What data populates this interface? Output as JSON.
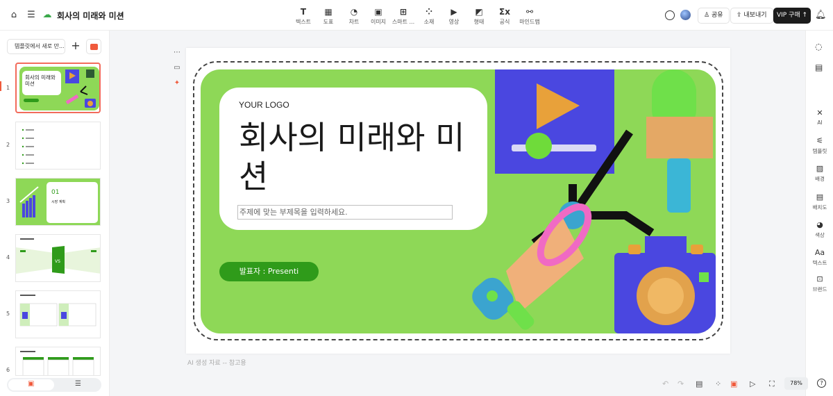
{
  "header": {
    "title": "회사의 미래와 미션",
    "tools": [
      {
        "label": "텍스트",
        "icon": "text-icon",
        "glyph": "T"
      },
      {
        "label": "도표",
        "icon": "table-icon",
        "glyph": "▦"
      },
      {
        "label": "차트",
        "icon": "chart-icon",
        "glyph": "◔"
      },
      {
        "label": "이미지",
        "icon": "image-icon",
        "glyph": "▣"
      },
      {
        "label": "스마트 ...",
        "icon": "smart-art-icon",
        "glyph": "⊞"
      },
      {
        "label": "소재",
        "icon": "elements-icon",
        "glyph": "⁘"
      },
      {
        "label": "영상",
        "icon": "video-icon",
        "glyph": "▶"
      },
      {
        "label": "형태",
        "icon": "shape-icon",
        "glyph": "◩"
      },
      {
        "label": "공식",
        "icon": "formula-icon",
        "glyph": "Σx"
      },
      {
        "label": "마인드맵",
        "icon": "mindmap-icon",
        "glyph": "⚯"
      }
    ],
    "share_label": "공유",
    "export_label": "내보내기",
    "vip_label": "VIP 구매"
  },
  "sidebar": {
    "template_button": "템플릿에서 새로 만...",
    "slides": [
      {
        "number": "1",
        "title": "회사의 미래와 미션"
      },
      {
        "number": "2",
        "title": ""
      },
      {
        "number": "3",
        "title": "01 시장 계획"
      },
      {
        "number": "4",
        "title": "VS"
      },
      {
        "number": "5",
        "title": ""
      },
      {
        "number": "6",
        "title": ""
      }
    ]
  },
  "slide": {
    "logo": "YOUR LOGO",
    "title": "회사의 미래와 미션",
    "subtitle": "주제에 맞는 부제목을 입력하세요.",
    "presenter": "발표자 :  Presenti"
  },
  "right_panel": {
    "tools": [
      {
        "label": "AI",
        "glyph": "✕"
      },
      {
        "label": "템플릿",
        "glyph": "⚟"
      },
      {
        "label": "배경",
        "glyph": "▨"
      },
      {
        "label": "배치도",
        "glyph": "▤"
      },
      {
        "label": "색상",
        "glyph": "◕"
      },
      {
        "label": "텍스트",
        "glyph": "Aa"
      },
      {
        "label": "브랜드",
        "glyph": "⊡"
      }
    ]
  },
  "footer": {
    "ai_note": "AI 생성 자료 -- 참고용",
    "zoom": "78%"
  },
  "colors": {
    "slide_green": "#8ed857",
    "presenter_green": "#2f9b1a",
    "accent_red": "#f05a3c",
    "purple": "#4a47e0"
  }
}
